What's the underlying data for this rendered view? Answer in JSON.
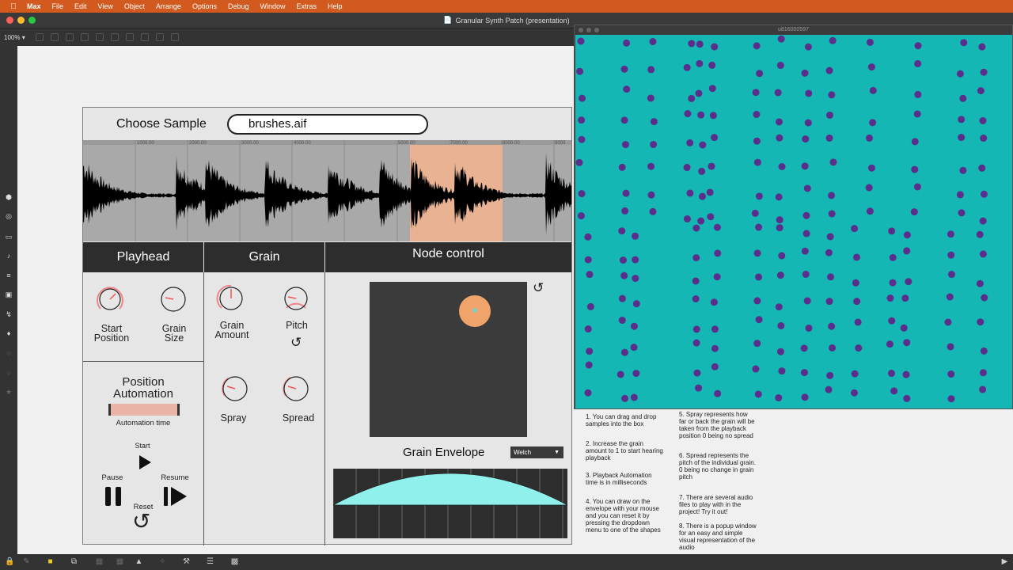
{
  "menubar": {
    "items": [
      "Max",
      "File",
      "Edit",
      "View",
      "Object",
      "Arrange",
      "Options",
      "Debug",
      "Window",
      "Extras",
      "Help"
    ]
  },
  "window": {
    "title": "Granular Synth Patch (presentation)"
  },
  "toolbar": {
    "zoom": "100%"
  },
  "patch": {
    "choose_label": "Choose Sample",
    "file_name": "brushes.aif",
    "sections": {
      "playhead": "Playhead",
      "grain": "Grain",
      "node": "Node control"
    },
    "knobs": {
      "start_position": "Start Position",
      "grain_size": "Grain Size",
      "grain_amount": "Grain Amount",
      "pitch": "Pitch",
      "spray": "Spray",
      "spread": "Spread"
    },
    "position_automation": {
      "title": "Position Automation",
      "bar_label": "Automation time",
      "start": "Start",
      "pause": "Pause",
      "resume": "Resume",
      "reset": "Reset"
    },
    "node": {
      "dot_label": "1"
    },
    "envelope": {
      "title": "Grain Envelope",
      "selected": "Welch"
    },
    "waveform_ticks": [
      "1000.00",
      "2000.00",
      "3000.00",
      "4000.00",
      "5000.00",
      "7000.00",
      "8000.00",
      "9000"
    ]
  },
  "popup": {
    "title": "u816000597"
  },
  "notes": {
    "n1": "1. You can drag and drop samples into the box",
    "n2": "2. Increase the grain amount to 1 to start hearing playback",
    "n3": "3. Playback Automation time is in milliseconds",
    "n4": "4. You can draw on the envelope with your mouse and you can reset it by pressing the dropdown menu to one of the shapes",
    "n5": "5. Spray represents how far or back the grain will be taken from the playback position 0 being no spread",
    "n6": "6. Spread represents the pitch of the individual grain. 0 being no change in grain pitch",
    "n7": "7. There are several audio files to play with in the project! Try it out!",
    "n8": "8. There is a popup window for an easy and simple visual representation of the audio"
  },
  "colors": {
    "menubar": "#d25a1e",
    "teal": "#14b7b3",
    "dot": "#5a2e8a",
    "selection": "#f0b490",
    "envelope_fill": "#8ff0ec"
  }
}
